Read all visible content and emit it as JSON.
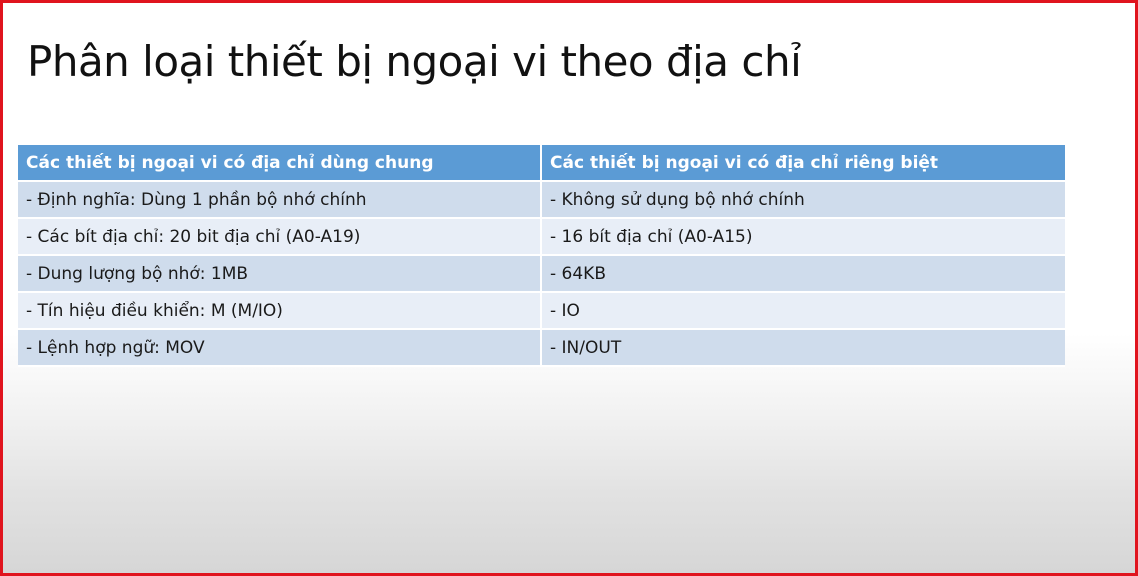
{
  "slide": {
    "title": "Phân loại thiết bị ngoại vi theo địa chỉ",
    "table": {
      "headers": [
        "Các thiết bị ngoại vi có địa chỉ dùng chung",
        "Các thiết bị ngoại vi có địa chỉ riêng biệt"
      ],
      "rows": [
        [
          "- Định nghĩa: Dùng 1 phần bộ nhớ chính",
          "- Không sử dụng bộ nhớ chính"
        ],
        [
          "- Các bít địa chỉ: 20 bit địa chỉ (A0-A19)",
          "- 16 bít địa chỉ (A0-A15)"
        ],
        [
          "- Dung lượng bộ nhớ: 1MB",
          "- 64KB"
        ],
        [
          "- Tín hiệu điều khiển: M (M/IO)",
          "- IO"
        ],
        [
          "- Lệnh hợp ngữ: MOV",
          "- IN/OUT"
        ]
      ]
    }
  },
  "colors": {
    "border": "#e0141e",
    "header_bg": "#5b9bd5",
    "row_odd": "#cfdcec",
    "row_even": "#e8eef7"
  }
}
